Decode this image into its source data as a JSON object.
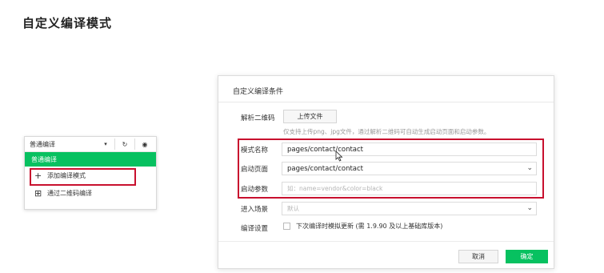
{
  "slide": {
    "title": "自定义编译模式"
  },
  "dropdown": {
    "mode_label": "普通编译",
    "caret": "▾",
    "refresh_icon": "↻",
    "preview_icon": "◉",
    "active_item": "普通编译",
    "items": [
      {
        "icon": "+",
        "label": "添加编译模式"
      },
      {
        "icon": "⊞",
        "label": "通过二维码编译"
      }
    ]
  },
  "dialog": {
    "title": "自定义编译条件",
    "qr": {
      "label": "解析二维码",
      "button": "上传文件",
      "hint": "仅支持上传png、jpg文件，通过解析二维码可自动生成启动页面和启动参数。"
    },
    "mode_name": {
      "label": "模式名称",
      "value": "pages/contact/contact"
    },
    "launch_page": {
      "label": "启动页面",
      "value": "pages/contact/contact"
    },
    "launch_params": {
      "label": "启动参数",
      "placeholder": "如：name=vendor&color=black"
    },
    "scene": {
      "label": "进入场景",
      "placeholder": "默认"
    },
    "compile_settings": {
      "label": "编译设置",
      "checkbox_label": "下次编译时模拟更新 (需 1.9.90 及以上基础库版本)"
    },
    "cancel_label": "取消",
    "ok_label": "确定"
  },
  "colors": {
    "accent_green": "#07c160",
    "highlight_red": "#c8102e"
  }
}
